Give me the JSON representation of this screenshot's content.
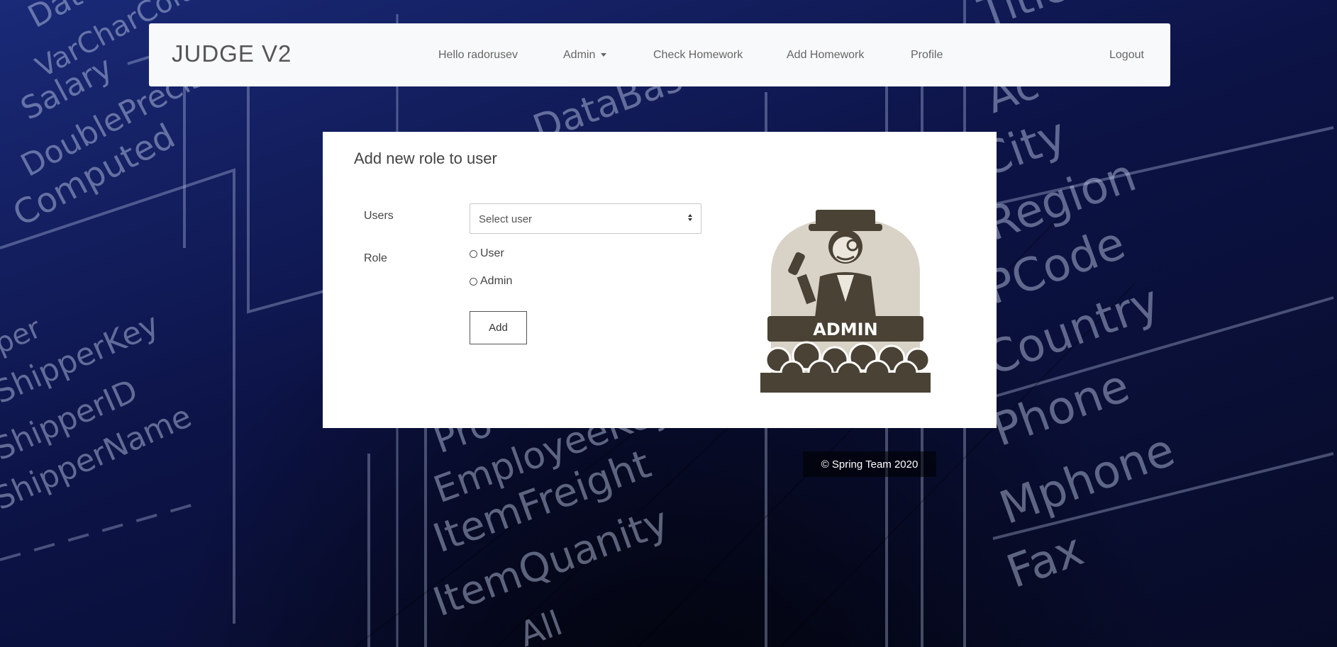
{
  "navbar": {
    "brand": "JUDGE V2",
    "greeting": "Hello radorusev",
    "admin_label": "Admin",
    "check_homework": "Check Homework",
    "add_homework": "Add Homework",
    "profile": "Profile",
    "logout": "Logout"
  },
  "form": {
    "title": "Add new role to user",
    "users_label": "Users",
    "users_select_value": "Select user",
    "role_label": "Role",
    "role_options": [
      "User",
      "Admin"
    ],
    "submit_label": "Add"
  },
  "logo": {
    "text": "ADMIN",
    "icon": "admin-judge-icon"
  },
  "footer": {
    "text": "© Spring Team 2020"
  },
  "background": {
    "words": [
      "Date",
      "VarCharColumn",
      "Salary",
      "DoublePrecision",
      "Computed",
      "DataBase",
      "Title",
      "Ac",
      "City",
      "Region",
      "PCode",
      "Country",
      "Phone",
      "Mphone",
      "Fax",
      "ShipperKey",
      "ShipperID",
      "ShipperName",
      "Pro",
      "EmployeeKey",
      "ItemFreight",
      "ItemQuanity",
      "All",
      "per"
    ]
  },
  "colors": {
    "navbar_bg": "#f8f9fa",
    "card_bg": "#ffffff",
    "logo_dark": "#4a4234",
    "logo_light": "#d9d3c7"
  }
}
